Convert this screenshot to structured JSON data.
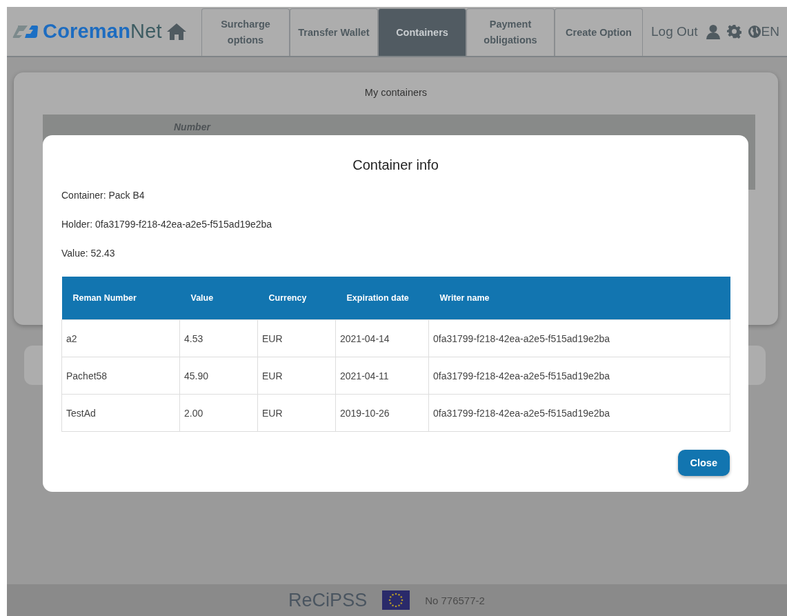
{
  "header": {
    "logo": {
      "brand_main": "Coreman",
      "brand_suffix": "Net"
    },
    "tabs": [
      {
        "label": "Surcharge options",
        "selected": false
      },
      {
        "label": "Transfer Wallet",
        "selected": false
      },
      {
        "label": "Containers",
        "selected": true
      },
      {
        "label": "Payment obligations",
        "selected": false
      },
      {
        "label": "Create Option",
        "selected": false
      }
    ],
    "logout": "Log Out",
    "language": "EN"
  },
  "page": {
    "card_title": "My containers",
    "column_heading": "Number"
  },
  "modal": {
    "title": "Container info",
    "fields": [
      "Container: Pack B4",
      "Holder: 0fa31799-f218-42ea-a2e5-f515ad19e2ba",
      "Value: 52.43"
    ],
    "table": {
      "columns": [
        "Reman Number",
        "Value",
        "Currency",
        "Expiration date",
        "Writer name"
      ],
      "rows": [
        [
          "a2",
          "4.53",
          "EUR",
          "2021-04-14",
          "0fa31799-f218-42ea-a2e5-f515ad19e2ba"
        ],
        [
          "Pachet58",
          "45.90",
          "EUR",
          "2021-04-11",
          "0fa31799-f218-42ea-a2e5-f515ad19e2ba"
        ],
        [
          "TestAd",
          "2.00",
          "EUR",
          "2019-10-26",
          "0fa31799-f218-42ea-a2e5-f515ad19e2ba"
        ]
      ]
    },
    "close_button": "Close"
  },
  "footer": {
    "project": "ReCiPSS",
    "grant": "No 776577-2"
  }
}
